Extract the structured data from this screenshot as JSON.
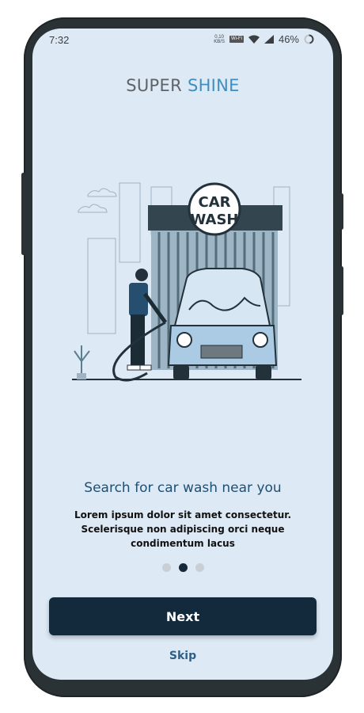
{
  "status_bar": {
    "time": "7:32",
    "net_speed_value": "0.10",
    "net_speed_unit": "KB/S",
    "wifi_call_label": "Wi-Fi",
    "battery": "46%"
  },
  "brand": {
    "part1": "SUPER",
    "part2": "SHINE",
    "accent_color": "#3f8ec0"
  },
  "illustration": {
    "sign_line1": "CAR",
    "sign_line2": "WASH"
  },
  "onboarding": {
    "headline": "Search for car wash near you",
    "body": "Lorem ipsum dolor sit amet consectetur. Scelerisque non adipiscing orci neque condimentum lacus",
    "page_count": 3,
    "active_page": 2
  },
  "actions": {
    "next_label": "Next",
    "skip_label": "Skip"
  },
  "colors": {
    "background": "#dde9f5",
    "primary_button": "#132a3d",
    "headline": "#1f4f72"
  }
}
